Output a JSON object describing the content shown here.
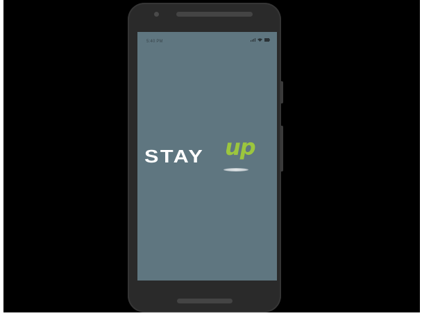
{
  "status_bar": {
    "time": "5:40 PM",
    "icons": [
      "signal-icon",
      "wifi-icon",
      "battery-icon"
    ]
  },
  "splash": {
    "logo_text_main": "STAY",
    "logo_text_accent": "up",
    "background_color": "#5f7680",
    "accent_color": "#9cc63e"
  }
}
